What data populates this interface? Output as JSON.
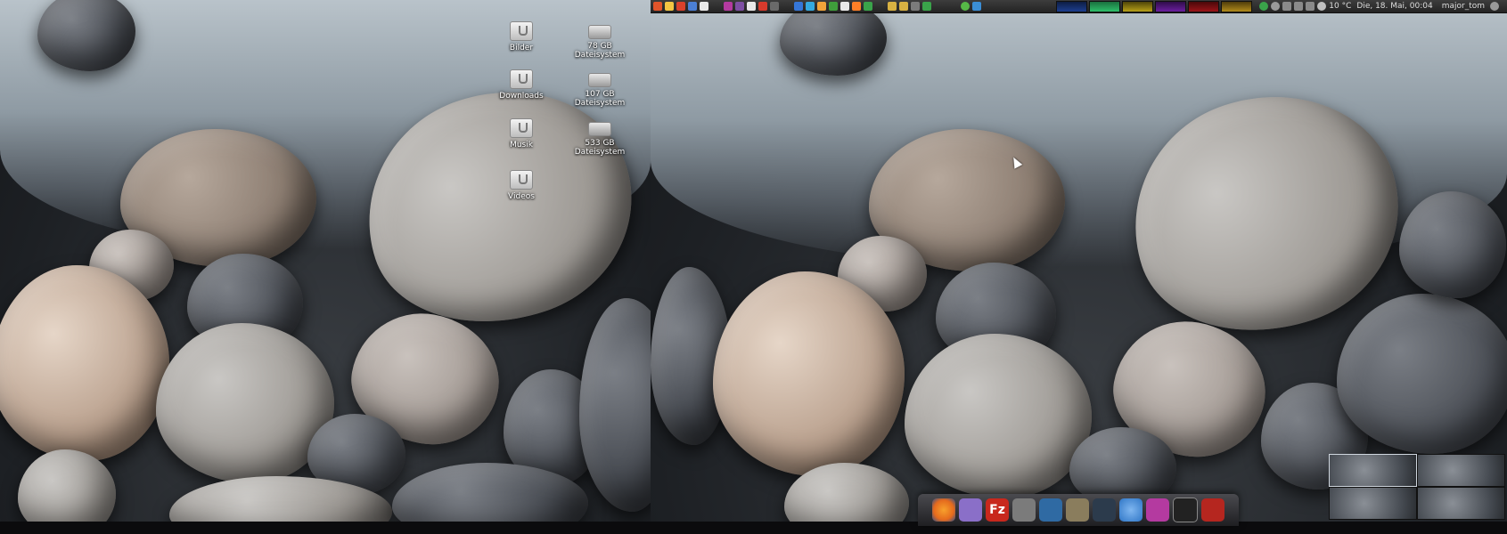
{
  "desktop": {
    "left_icons": [
      {
        "label": "Bilder",
        "kind": "folder"
      },
      {
        "label": "78 GB Dateisystem",
        "kind": "drive"
      },
      {
        "label": "Downloads",
        "kind": "folder"
      },
      {
        "label": "107 GB Dateisystem",
        "kind": "drive"
      },
      {
        "label": "Musik",
        "kind": "folder"
      },
      {
        "label": "533 GB Dateisystem",
        "kind": "drive"
      },
      {
        "label": "Videos",
        "kind": "folder"
      }
    ]
  },
  "panel": {
    "launcher_icon_colors": [
      "#e0542a",
      "#f4c542",
      "#d9412c",
      "#4b7fd4",
      "#e9e9e9",
      "#3aa0e6",
      "#7e4fa3",
      "#e9e9e9",
      "#d73a2c",
      "#6a6a6a",
      "#3576d8",
      "#34a9e0",
      "#f2a33a",
      "#3f9e3b",
      "#d8b142",
      "#ff7f27",
      "#3aa34a"
    ],
    "graph_colors": [
      "#1d3f8f",
      "#2fbf6a",
      "#b7a018",
      "#6b1fa0",
      "#9b1418",
      "#b18b1b"
    ],
    "weather": "10 °C",
    "clock": "Die, 18. Mai, 00:04",
    "user": "major_tom"
  },
  "dock": {
    "items": [
      {
        "name": "firefox",
        "color": "#e56a1d"
      },
      {
        "name": "pidgin",
        "color": "#8a6fc8"
      },
      {
        "name": "filezilla",
        "color": "#c8281d",
        "text": "Fz"
      },
      {
        "name": "calculator",
        "color": "#7b7b7b"
      },
      {
        "name": "downloader",
        "color": "#2f6aa3"
      },
      {
        "name": "gimp",
        "color": "#8a7d5d"
      },
      {
        "name": "web",
        "color": "#2c3b4c"
      },
      {
        "name": "globe",
        "color": "#2f76c6"
      },
      {
        "name": "screen",
        "color": "#b43aa0"
      },
      {
        "name": "terminal",
        "color": "#222222"
      },
      {
        "name": "presentation",
        "color": "#b5261f"
      }
    ]
  },
  "pager": {
    "workspaces": 4,
    "active": 1
  }
}
